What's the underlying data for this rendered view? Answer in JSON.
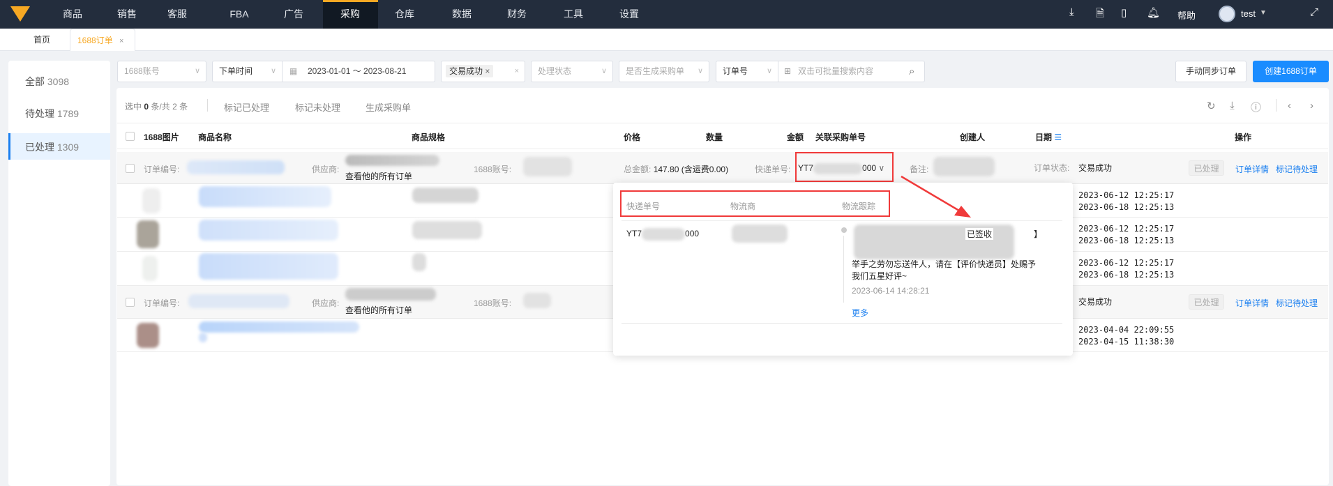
{
  "nav": {
    "items": [
      "商品",
      "销售",
      "客服",
      "FBA",
      "广告",
      "采购",
      "仓库",
      "数据",
      "财务",
      "工具",
      "设置"
    ],
    "active": "采购",
    "help": "帮助",
    "user": "test"
  },
  "tabs": [
    {
      "label": "首页"
    },
    {
      "label": "1688订单",
      "close": "×"
    }
  ],
  "sidebar": [
    {
      "label": "全部",
      "count": "3098"
    },
    {
      "label": "待处理",
      "count": "1789"
    },
    {
      "label": "已处理",
      "count": "1309"
    }
  ],
  "filters": {
    "account": "1688账号",
    "time_type": "下单时间",
    "date_range": "2023-01-01 ～ 2023-08-21",
    "status_tag": "交易成功",
    "process_status": "处理状态",
    "po_generated": "是否生成采购单",
    "search_type": "订单号",
    "search_placeholder": "双击可批量搜索内容",
    "sync_button": "手动同步订单",
    "create_button": "创建1688订单"
  },
  "toolbar": {
    "selected_prefix": "选中",
    "selected": "0",
    "selected_mid": "条/共",
    "total": "2",
    "selected_suffix": "条",
    "mark_done": "标记已处理",
    "mark_undone": "标记未处理",
    "generate_po": "生成采购单"
  },
  "columns": [
    "1688图片",
    "商品名称",
    "商品规格",
    "价格",
    "数量",
    "金额",
    "关联采购单号",
    "创建人",
    "日期",
    "操作"
  ],
  "groups": [
    {
      "order_no_label": "订单编号:",
      "supplier_label": "供应商:",
      "view_all": "查看他的所有订单",
      "account_label": "1688账号:",
      "total_label": "总金额:",
      "total": "147.80 (含运费0.00)",
      "tracking_label": "快递单号:",
      "tracking_prefix": "YT7",
      "tracking_suffix": "000",
      "remark_label": "备注:",
      "status_label": "订单状态:",
      "status": "交易成功",
      "badge": "已处理",
      "detail": "订单详情",
      "mark_pending": "标记待处理",
      "rows": [
        {
          "d1": "2023-06-12 12:25:17",
          "d2": "2023-06-18 12:25:13"
        },
        {
          "d1": "2023-06-12 12:25:17",
          "d2": "2023-06-18 12:25:13"
        },
        {
          "d1": "2023-06-12 12:25:17",
          "d2": "2023-06-18 12:25:13"
        }
      ]
    },
    {
      "order_no_label": "订单编号:",
      "supplier_label": "供应商:",
      "view_all": "查看他的所有订单",
      "account_label": "1688账号:",
      "status": "交易成功",
      "badge": "已处理",
      "detail": "订单详情",
      "mark_pending": "标记待处理",
      "rows": [
        {
          "d1": "2023-04-04 22:09:55",
          "d2": "2023-04-15 11:38:30"
        }
      ]
    }
  ],
  "popover": {
    "headers": [
      "快递单号",
      "物流商",
      "物流跟踪"
    ],
    "tracking_prefix": "YT7",
    "tracking_suffix": "000",
    "signed": "已签收",
    "bracket": "】",
    "message": "举手之劳勿忘送件人，请在【评价快递员】处赐予我们五星好评~",
    "time": "2023-06-14 14:28:21",
    "more": "更多"
  },
  "colors": {
    "nav_bg": "#232d3d",
    "accent": "#f7a823",
    "primary": "#1a7ff0",
    "highlight": "#f03a3a"
  }
}
